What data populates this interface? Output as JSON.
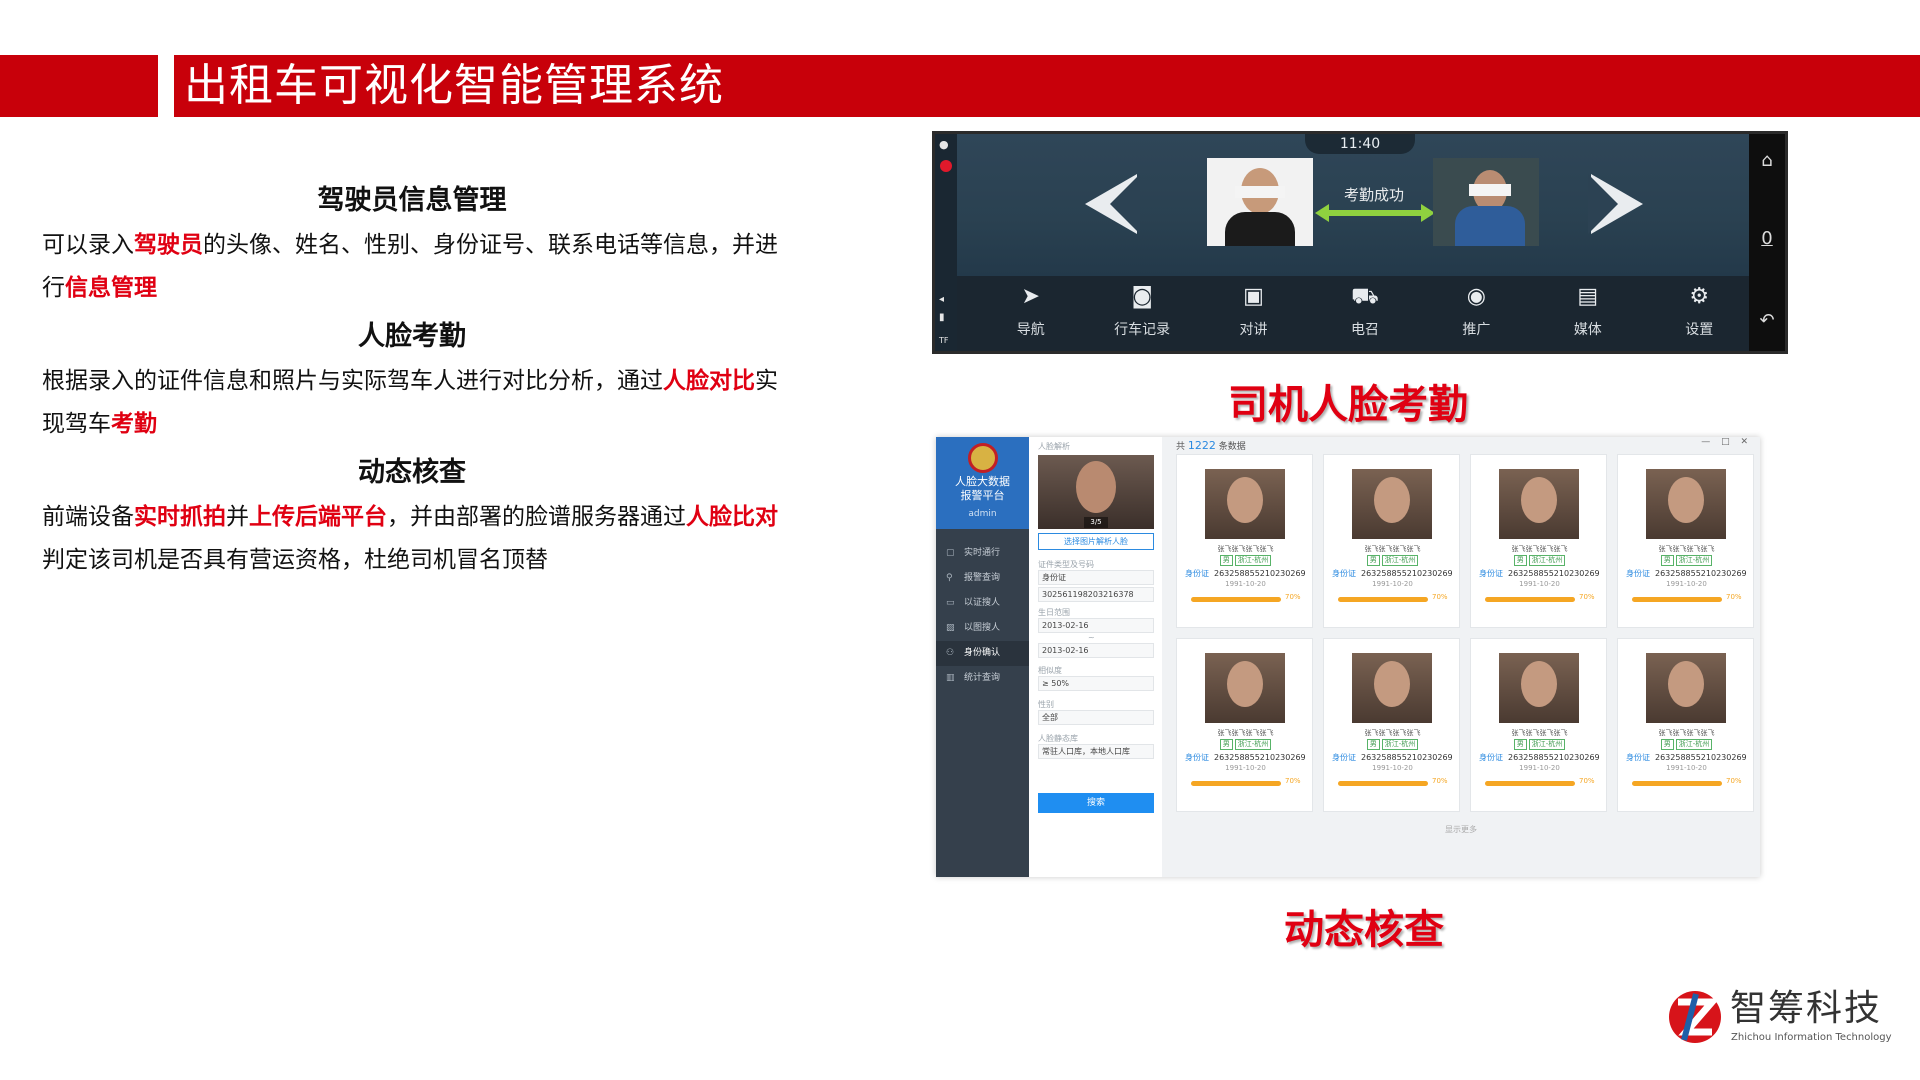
{
  "header": {
    "title": "出租车可视化智能管理系统"
  },
  "sections": [
    {
      "heading": "驾驶员信息管理",
      "p1": "可以录入",
      "h1": "驾驶员",
      "p2": "的头像、姓名、性别、身份证号、联系电话等信息，并进行",
      "h2": "信息管理"
    },
    {
      "heading": "人脸考勤",
      "p1": "根据录入的证件信息和照片与实际驾车人进行对比分析，通过",
      "h1": "人脸对比",
      "p2": "实现驾车",
      "h2": "考勤"
    },
    {
      "heading": "动态核查",
      "p1": "前端设备",
      "h1": "实时抓拍",
      "p2": "并",
      "h2": "上传后端平台",
      "p3": "，并由部署的脸谱服务器通过",
      "h3": "人脸比对",
      "p4": "判定该司机是否具有营运资格，杜绝司机冒名顶替"
    }
  ],
  "car_screen": {
    "time": "11:40",
    "status_text": "考勤成功",
    "menu": [
      {
        "icon": "navigation-icon",
        "glyph": "➤",
        "label": "导航"
      },
      {
        "icon": "camera-icon",
        "glyph": "◙",
        "label": "行车记录"
      },
      {
        "icon": "intercom-icon",
        "glyph": "▣",
        "label": "对讲"
      },
      {
        "icon": "taxi-call-icon",
        "glyph": "⛟",
        "label": "电召"
      },
      {
        "icon": "promotion-icon",
        "glyph": "◉",
        "label": "推广"
      },
      {
        "icon": "media-icon",
        "glyph": "▤",
        "label": "媒体"
      },
      {
        "icon": "settings-gear-icon",
        "glyph": "⚙",
        "label": "设置"
      }
    ],
    "side_icons": [
      {
        "icon": "home-icon",
        "glyph": "⌂"
      },
      {
        "icon": "zero-icon",
        "glyph": "0"
      },
      {
        "icon": "back-icon",
        "glyph": "↶"
      }
    ],
    "left_icons": [
      {
        "icon": "location-pin-icon",
        "glyph": "●"
      },
      {
        "icon": "volume-icon",
        "glyph": "◂"
      },
      {
        "icon": "signal-icon",
        "glyph": "▮"
      },
      {
        "icon": "tf-card-icon",
        "glyph": "TF"
      }
    ]
  },
  "caption_face": "司机人脸考勤",
  "caption_dynamic": "动态核查",
  "web": {
    "app_name_line1": "人脸大数据",
    "app_name_line2": "报警平台",
    "user": "admin",
    "nav": [
      {
        "icon": "camera-icon",
        "glyph": "▢",
        "label": "实时通行",
        "active": false
      },
      {
        "icon": "search-icon",
        "glyph": "⚲",
        "label": "报警查询",
        "active": false
      },
      {
        "icon": "id-card-icon",
        "glyph": "▭",
        "label": "以证搜人",
        "active": false
      },
      {
        "icon": "image-search-icon",
        "glyph": "▨",
        "label": "以图搜人",
        "active": false
      },
      {
        "icon": "identity-confirm-icon",
        "glyph": "⚇",
        "label": "身份确认",
        "active": true
      },
      {
        "icon": "bar-chart-icon",
        "glyph": "▥",
        "label": "统计查询",
        "active": false
      }
    ],
    "filter": {
      "face_label": "人脸解析",
      "photo_counter": "3/5",
      "select_btn": "选择图片解析人脸",
      "id_label": "证件类型及号码",
      "id_type": "身份证",
      "id_number": "302561198203216378",
      "birth_label": "生日范围",
      "date_from": "2013-02-16",
      "date_sep": "~",
      "date_to": "2013-02-16",
      "similarity_label": "相似度",
      "similarity": "≥  50%",
      "gender_label": "性别",
      "gender": "全部",
      "db_label": "人脸静态库",
      "db": "常驻人口库，本地人口库",
      "search_btn": "搜索"
    },
    "results": {
      "count_prefix": "共",
      "count": "1222",
      "count_suffix": "条数据",
      "window_controls": "— □ ✕",
      "more": "显示更多",
      "cards": [
        {
          "name": "张飞张飞张飞张飞",
          "gender": "男",
          "region": "浙江-杭州",
          "id_label": "身份证",
          "id": "263258855210230269",
          "date": "1991-10-20",
          "percent": "70%"
        },
        {
          "name": "张飞张飞张飞张飞",
          "gender": "男",
          "region": "浙江-杭州",
          "id_label": "身份证",
          "id": "263258855210230269",
          "date": "1991-10-20",
          "percent": "70%"
        },
        {
          "name": "张飞张飞张飞张飞",
          "gender": "男",
          "region": "浙江-杭州",
          "id_label": "身份证",
          "id": "263258855210230269",
          "date": "1991-10-20",
          "percent": "70%"
        },
        {
          "name": "张飞张飞张飞张飞",
          "gender": "男",
          "region": "浙江-杭州",
          "id_label": "身份证",
          "id": "263258855210230269",
          "date": "1991-10-20",
          "percent": "70%"
        },
        {
          "name": "张飞张飞张飞张飞",
          "gender": "男",
          "region": "浙江-杭州",
          "id_label": "身份证",
          "id": "263258855210230269",
          "date": "1991-10-20",
          "percent": "70%"
        },
        {
          "name": "张飞张飞张飞张飞",
          "gender": "男",
          "region": "浙江-杭州",
          "id_label": "身份证",
          "id": "263258855210230269",
          "date": "1991-10-20",
          "percent": "70%"
        },
        {
          "name": "张飞张飞张飞张飞",
          "gender": "男",
          "region": "浙江-杭州",
          "id_label": "身份证",
          "id": "263258855210230269",
          "date": "1991-10-20",
          "percent": "70%"
        },
        {
          "name": "张飞张飞张飞张飞",
          "gender": "男",
          "region": "浙江-杭州",
          "id_label": "身份证",
          "id": "263258855210230269",
          "date": "1991-10-20",
          "percent": "70%"
        }
      ]
    }
  },
  "logo": {
    "name": "智筹科技",
    "sub": "Zhichou Information Technology",
    "color_red": "#d7141a",
    "color_blue": "#1f5fa8"
  },
  "colors": {
    "header_red": "#c8000a",
    "highlight_red": "#e00012"
  }
}
